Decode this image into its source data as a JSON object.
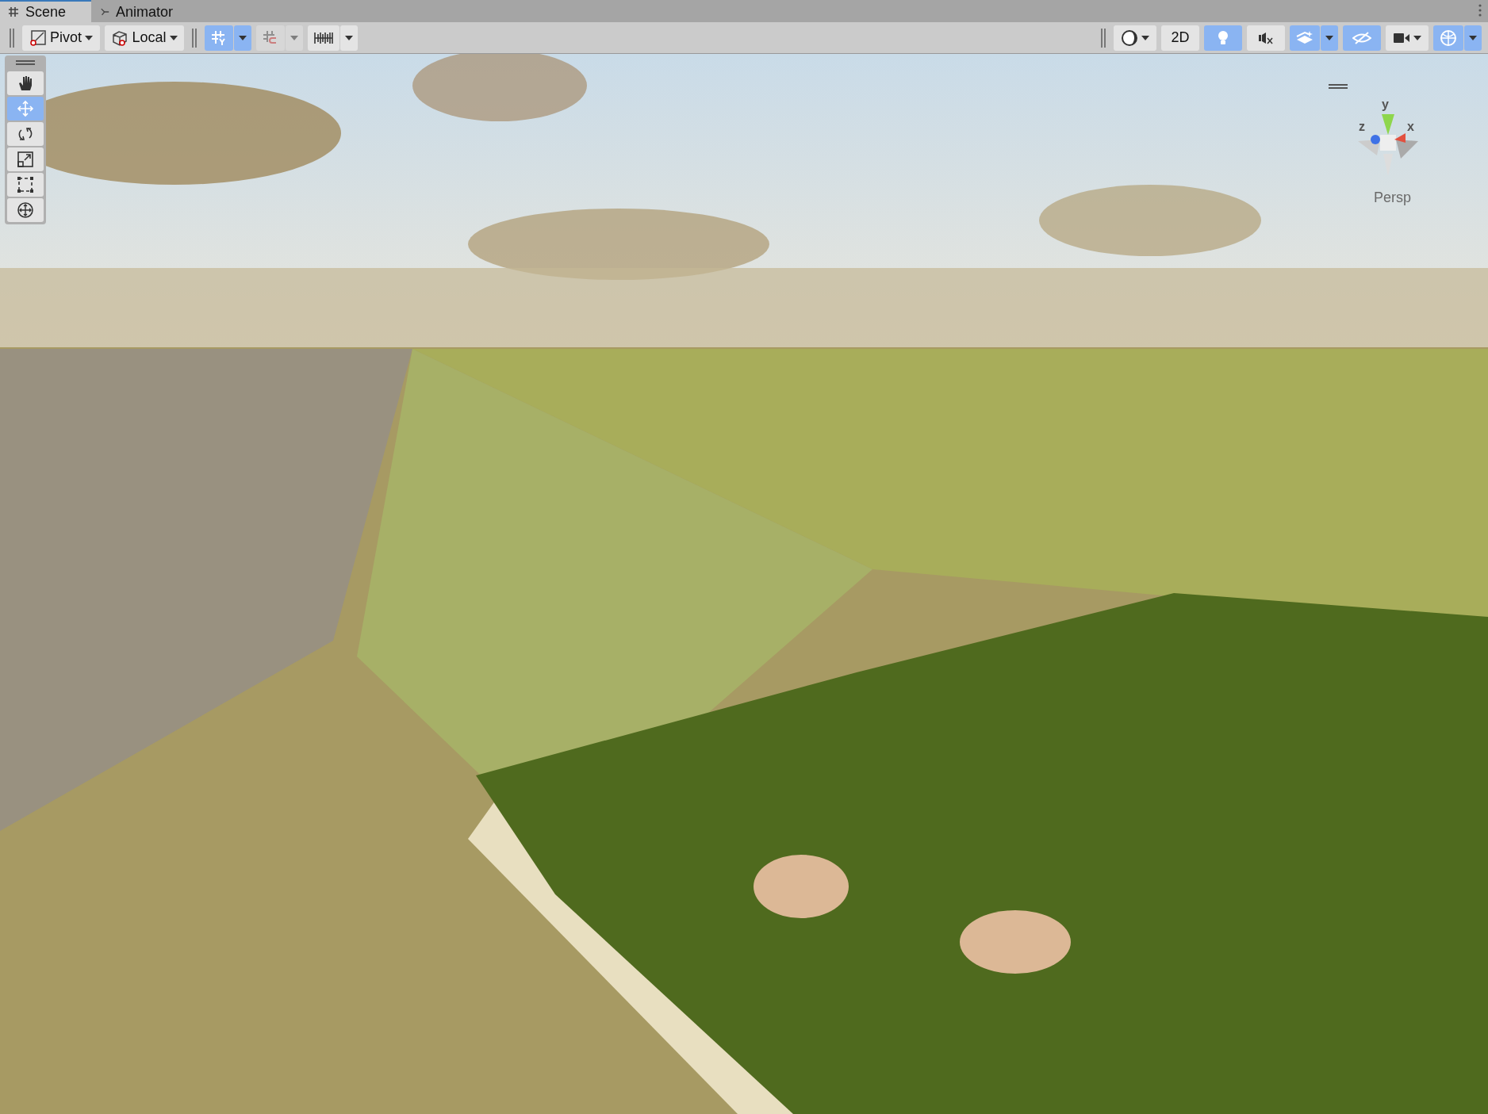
{
  "tabs": [
    {
      "label": "Scene",
      "kind": "scene",
      "selected": true
    },
    {
      "label": "Animator",
      "kind": "animator",
      "selected": false
    }
  ],
  "toolbar": {
    "pivot": {
      "label": "Pivot"
    },
    "space": {
      "label": "Local"
    },
    "grid_snapping": {
      "on": true
    },
    "increment_snap": {
      "on": false,
      "disabled": true
    },
    "grid": {
      "on": false
    },
    "shading": {
      "on": false
    },
    "mode_2d": {
      "label": "2D",
      "on": false
    },
    "lighting": {
      "on": true
    },
    "audio": {
      "on": false
    },
    "effects": {
      "on": true
    },
    "visibility": {
      "on": true
    },
    "camera": {
      "on": false
    },
    "gizmos": {
      "on": true
    }
  },
  "tools": [
    {
      "kind": "hand",
      "selected": false
    },
    {
      "kind": "move",
      "selected": true
    },
    {
      "kind": "rotate",
      "selected": false
    },
    {
      "kind": "scale",
      "selected": false
    },
    {
      "kind": "rect",
      "selected": false
    },
    {
      "kind": "transform",
      "selected": false
    }
  ],
  "orientation_gizmo": {
    "axes": [
      "y",
      "z",
      "x"
    ],
    "projection": "Persp"
  }
}
